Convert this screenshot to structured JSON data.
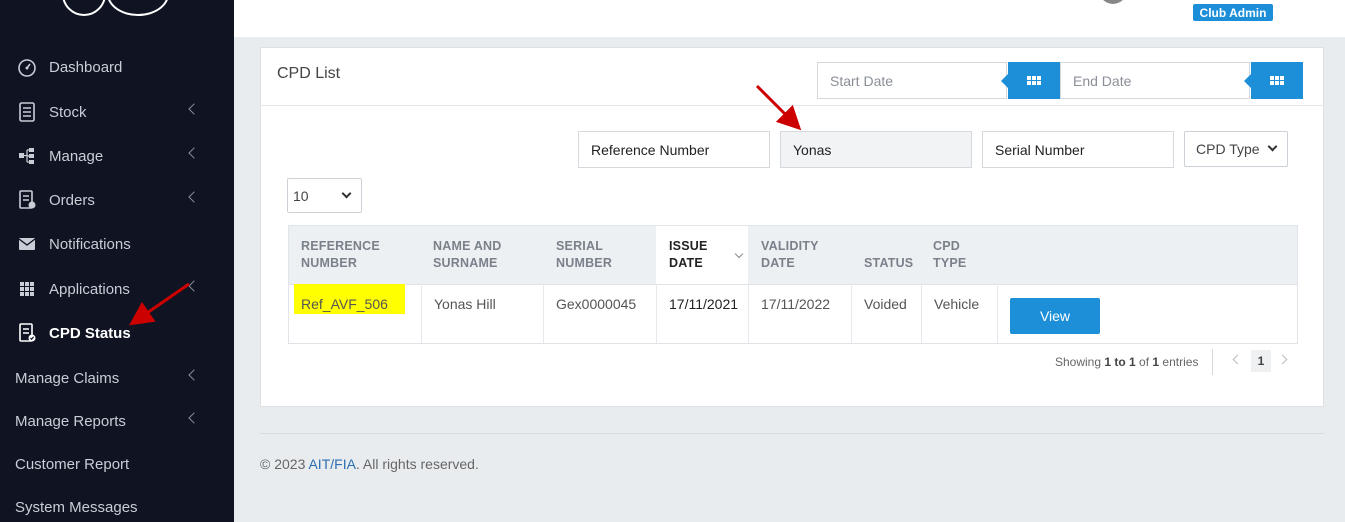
{
  "sidebar": {
    "items": [
      {
        "label": "Dashboard",
        "icon": "speedometer-icon"
      },
      {
        "label": "Stock",
        "icon": "document-icon"
      },
      {
        "label": "Manage",
        "icon": "sitemap-icon"
      },
      {
        "label": "Orders",
        "icon": "order-list-icon"
      },
      {
        "label": "Notifications",
        "icon": "envelope-icon"
      },
      {
        "label": "Applications",
        "icon": "grid-icon"
      },
      {
        "label": "CPD Status",
        "icon": "clipboard-check-icon"
      },
      {
        "label": "Manage Claims"
      },
      {
        "label": "Manage Reports"
      },
      {
        "label": "Customer Report"
      },
      {
        "label": "System Messages"
      }
    ]
  },
  "header": {
    "role_badge": "Club Admin"
  },
  "card": {
    "title": "CPD List",
    "start_date_placeholder": "Start Date",
    "end_date_placeholder": "End Date"
  },
  "filters": {
    "reference_number": "Reference Number",
    "name": "Yonas",
    "serial_number": "Serial Number",
    "cpd_type": "CPD Type",
    "page_size": "10"
  },
  "table": {
    "headers": [
      [
        "REFERENCE",
        "NUMBER"
      ],
      [
        "NAME AND",
        "SURNAME"
      ],
      [
        "SERIAL",
        "NUMBER"
      ],
      [
        "ISSUE",
        "DATE"
      ],
      [
        "VALIDITY",
        "DATE"
      ],
      [
        "STATUS"
      ],
      [
        "CPD",
        "TYPE"
      ]
    ],
    "rows": [
      {
        "reference": "Ref_AVF_506",
        "name": "Yonas Hill",
        "serial": "Gex0000045",
        "issue_date": "17/11/2021",
        "validity_date": "17/11/2022",
        "status": "Voided",
        "cpd_type": "Vehicle",
        "action": "View"
      }
    ]
  },
  "pagination": {
    "showing_prefix": "Showing ",
    "from_to": "1 to 1",
    "of": " of ",
    "total": "1",
    "suffix": " entries",
    "current_page": "1"
  },
  "footer": {
    "prefix": "© 2023 ",
    "link": "AIT/FIA",
    "suffix": ". All rights reserved."
  },
  "colors": {
    "sidebar_bg": "#0f1322",
    "accent": "#1d8fd8",
    "highlight": "#ffff00",
    "annotation_arrow": "#cc0000"
  }
}
